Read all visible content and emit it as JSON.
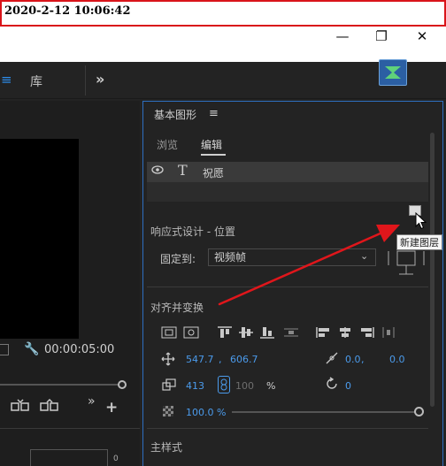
{
  "timestamp": "2020-2-12 10:06:42",
  "window": {
    "minimize_glyph": "—",
    "restore_glyph": "❐",
    "close_glyph": "✕"
  },
  "topbar": {
    "menu_glyph": "≡",
    "library_label": "库",
    "more_glyph": "»",
    "logo_icon": "premiere-logo-icon"
  },
  "left_panel": {
    "timecode": "00:00:05:00",
    "wrench_glyph": "🔧",
    "more_glyph": "»",
    "add_glyph": "+",
    "right_mark": "0"
  },
  "graphics_panel": {
    "title": "基本图形",
    "menu_glyph": "≡",
    "tabs": [
      {
        "label": "浏览",
        "active": false
      },
      {
        "label": "编辑",
        "active": true
      }
    ],
    "layer": {
      "eye_glyph": "👁",
      "type_glyph": "T",
      "name": "祝愿"
    },
    "new_layer_tooltip": "新建图层",
    "responsive": {
      "title": "响应式设计 - 位置",
      "pin_label": "固定到:",
      "pin_value": "视频帧",
      "dropdown_glyph": "⌄"
    },
    "align": {
      "title": "对齐并变换"
    },
    "transform": {
      "pos_x": "547.7",
      "pos_y": "606.7",
      "pos_sep": ",",
      "anchor_x": "0.0",
      "anchor_y": "0.0",
      "anchor_sep": ",",
      "scale": "413",
      "scale_locked": "100",
      "scale_unit": "%",
      "rotation": "0",
      "opacity": "100.0 %"
    },
    "master_style": {
      "title": "主样式"
    }
  },
  "colors": {
    "background": "#232323",
    "accent_blue": "#4b9bec",
    "annotation_red": "#e0161b",
    "panel_border": "#2e6fc0"
  }
}
